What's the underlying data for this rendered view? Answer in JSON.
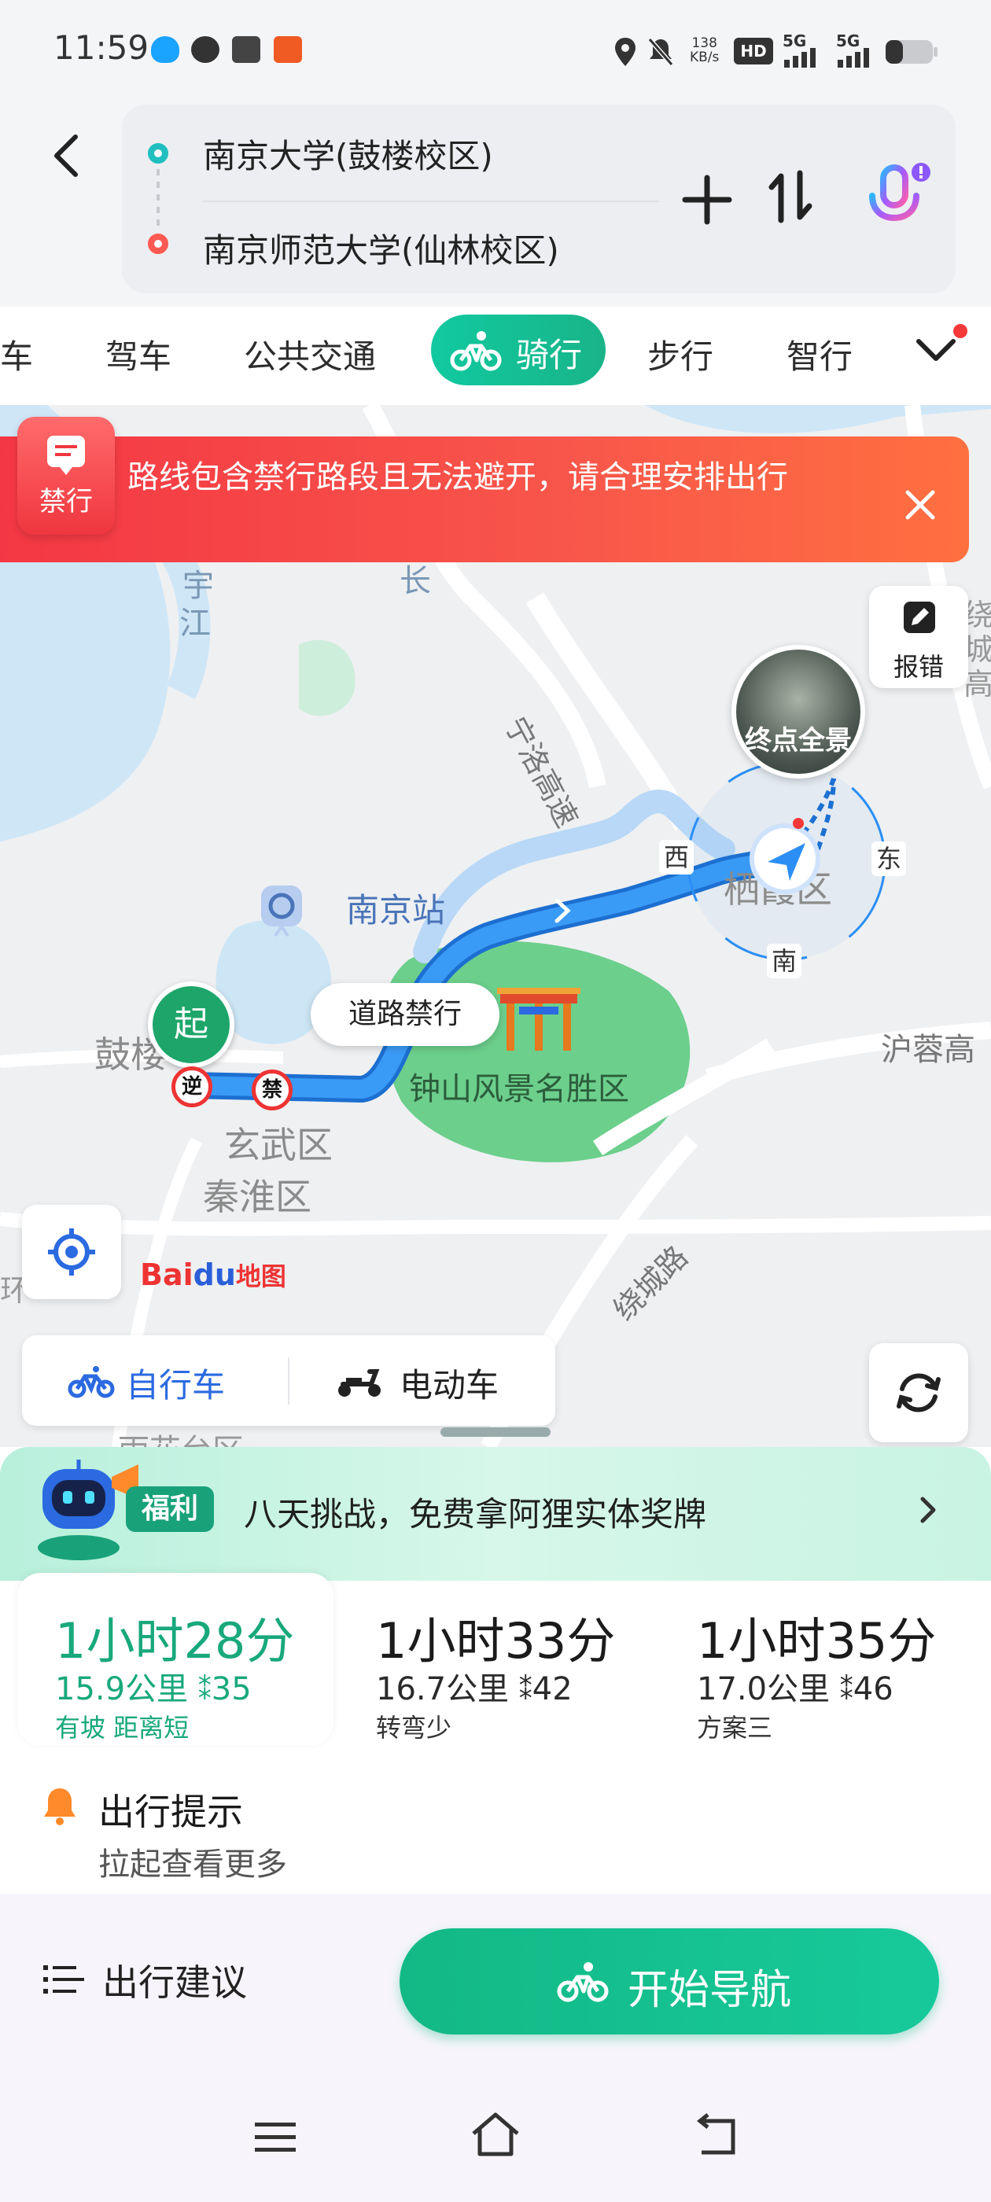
{
  "status_bar": {
    "time": "11:59",
    "net_speed_value": "138",
    "net_speed_unit": "KB/s",
    "hd_badge": "HD",
    "sim1_label": "5G",
    "sim2_label": "5G"
  },
  "route_inputs": {
    "origin": "南京大学(鼓楼校区)",
    "destination": "南京师范大学(仙林校区)"
  },
  "mode_tabs": {
    "partial": "车",
    "drive": "驾车",
    "transit": "公共交通",
    "cycling": "骑行",
    "walk": "步行",
    "smart": "智行"
  },
  "banner": {
    "badge_label": "禁行",
    "message": "路线包含禁行路段且无法避开，请合理安排出行"
  },
  "map": {
    "report_label": "报错",
    "end_view_label": "终点全景",
    "start_label": "起",
    "road_ban_label": "道路禁行",
    "sign_reverse": "逆",
    "sign_ban": "禁",
    "compass": {
      "west": "西",
      "east": "东",
      "south": "南"
    },
    "places": {
      "nanjing_station": "南京站",
      "zhongshan": "钟山风景名胜区",
      "xuanwu": "玄武区",
      "qinhuai": "秦淮区",
      "qixia": "栖霞区",
      "gulou": "鼓楼",
      "ningluo": "宁洛高速",
      "huancheng": "绕城路",
      "hurong": "沪蓉高",
      "jiang": "江",
      "yu": "宇",
      "chang": "长",
      "nanhua": "雨花台区",
      "ring": "环",
      "right_edge": "绕城高"
    },
    "baidu_logo": {
      "bai": "Bai",
      "du": "du",
      "map": "地图"
    }
  },
  "vehicles": {
    "bike": "自行车",
    "ebike": "电动车"
  },
  "promo": {
    "tag": "福利",
    "text": "八天挑战，免费拿阿狸实体奖牌"
  },
  "routes": [
    {
      "time": "1小时28分",
      "distance": "15.9公里",
      "lights": "35",
      "tag": "有坡 距离短"
    },
    {
      "time": "1小时33分",
      "distance": "16.7公里",
      "lights": "42",
      "tag": "转弯少"
    },
    {
      "time": "1小时35分",
      "distance": "17.0公里",
      "lights": "46",
      "tag": "方案三"
    }
  ],
  "tips": {
    "title": "出行提示",
    "subtitle": "拉起查看更多"
  },
  "actions": {
    "advice": "出行建议",
    "start_nav": "开始导航"
  },
  "colors": {
    "accent": "#18a87c",
    "route_blue": "#2b8ef5",
    "banner_red": "#f43744"
  }
}
